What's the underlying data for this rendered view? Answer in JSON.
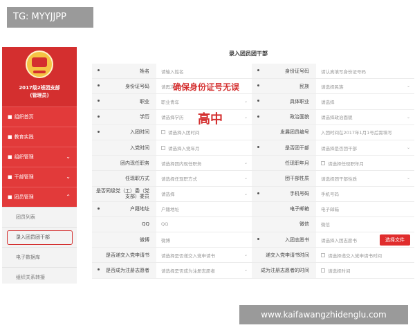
{
  "banners": {
    "top_left": "TG: MYYJJPP",
    "bottom_right": "www.kaifawangzhidenglu.com"
  },
  "sidebar": {
    "org_line1": "2017级2班团支部",
    "org_line2": "(管理员)",
    "items": [
      {
        "icon": "■",
        "label": "组织首页"
      },
      {
        "icon": "■",
        "label": "教育实践"
      },
      {
        "icon": "■",
        "label": "组织管理",
        "chev": "⌄"
      },
      {
        "icon": "■",
        "label": "干部管理",
        "chev": "⌄"
      },
      {
        "icon": "■",
        "label": "团员管理",
        "chev": "⌃"
      }
    ],
    "subitems": [
      "团员列表",
      "录入团员团干部",
      "电子数据库",
      "组织关系转接"
    ]
  },
  "form": {
    "title": "录入团员团干部",
    "rows": [
      {
        "l": "姓名",
        "lreq": true,
        "v": "请输入姓名",
        "r": "身份证号码",
        "rreq": true,
        "rv": "请认真填写身份证号码"
      },
      {
        "l": "身份证号码",
        "lreq": true,
        "v": "请再次",
        "r": "民族",
        "rreq": true,
        "rv": "请选择民族",
        "rdd": true
      },
      {
        "l": "职业",
        "lreq": true,
        "v": "职业青年",
        "vdd": true,
        "r": "具体职业",
        "rreq": true,
        "rv": "请选择"
      },
      {
        "l": "学历",
        "lreq": true,
        "v": "请选择学历",
        "vdd": true,
        "r": "政治面貌",
        "rreq": true,
        "rv": "请选择政治面貌",
        "rdd": true
      },
      {
        "l": "入团时间",
        "lreq": true,
        "v": "请选择入团时间",
        "vcal": true,
        "r": "发展团员编号",
        "rreq": false,
        "rv": "入团时间在2017年1月1号后需填写"
      },
      {
        "l": "入党时间",
        "lreq": false,
        "v": "请选择入党年月",
        "vcal": true,
        "r": "是否团干部",
        "rreq": true,
        "rv": "请选择是否团干部",
        "rdd": true
      },
      {
        "l": "团内现任职务",
        "lreq": false,
        "v": "请选择团内现任职务",
        "vdd": true,
        "r": "任现职年月",
        "rreq": false,
        "rv": "请选择任现职年月",
        "rcal": true
      },
      {
        "l": "任现职方式",
        "lreq": false,
        "v": "请选择任现职方式",
        "vdd": true,
        "r": "团干部性质",
        "rreq": false,
        "rv": "请选择团干部性质",
        "rdd": true
      },
      {
        "l": "是否同级党（工）委（党支部）委员",
        "lreq": false,
        "v": "请选择",
        "vdd": true,
        "r": "手机号码",
        "rreq": true,
        "rv": "手机号码"
      },
      {
        "l": "户籍地址",
        "lreq": true,
        "v": "户籍地址",
        "r": "电子邮箱",
        "rreq": false,
        "rv": "电子邮箱"
      },
      {
        "l": "QQ",
        "lreq": false,
        "v": "QQ",
        "r": "微信",
        "rreq": false,
        "rv": "微信"
      },
      {
        "l": "微博",
        "lreq": false,
        "v": "微博",
        "r": "入团志愿书",
        "rreq": true,
        "rv": "请选择入团志愿书",
        "upload": "选择文件"
      },
      {
        "l": "是否递交入党申请书",
        "lreq": false,
        "v": "请选择是否递交入党申请书",
        "vdd": true,
        "r": "递交入党申请书时间",
        "rreq": false,
        "rv": "请选择递交入党申请书时间",
        "rcal": true
      },
      {
        "l": "是否成为注册志愿者",
        "lreq": true,
        "v": "请选择是否成为注册志愿者",
        "vdd": true,
        "r": "成为注册志愿者的时间",
        "rreq": false,
        "rv": "请选择时间",
        "rcal": true
      }
    ]
  },
  "overlays": {
    "note1": "确保身份证号无误",
    "note2": "高中"
  }
}
